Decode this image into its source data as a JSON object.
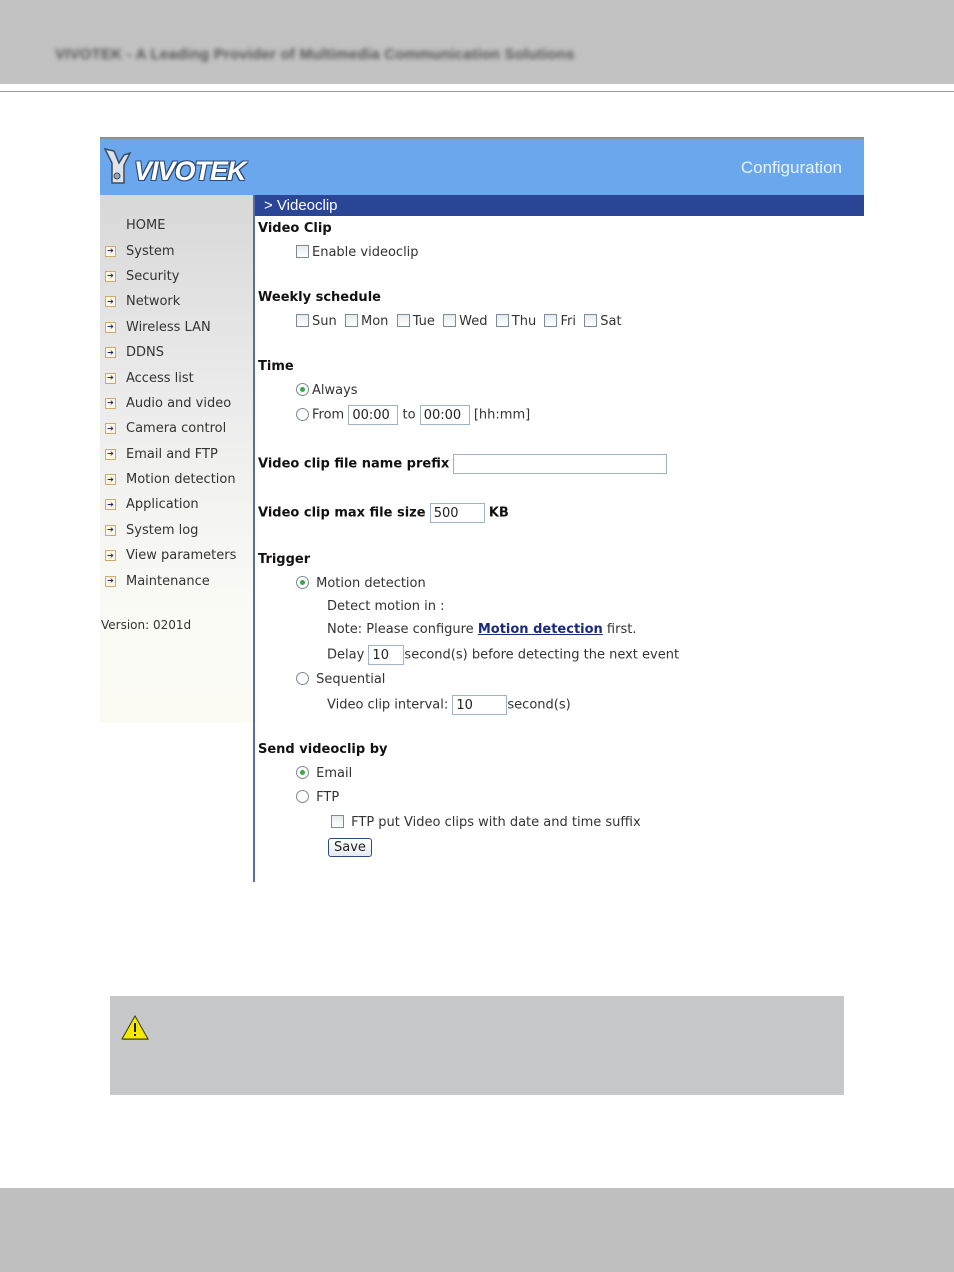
{
  "document": {
    "header_tagline": "VIVOTEK - A Leading Provider of Multimedia Communication Solutions"
  },
  "app": {
    "logo_text": "VIVOTEK",
    "banner_title": "Configuration",
    "section_title": "> Videoclip",
    "accent_color": "#2b4596",
    "banner_color": "#6ba7ec"
  },
  "sidebar": {
    "items": [
      {
        "label": "HOME",
        "icon": "none"
      },
      {
        "label": "System",
        "icon": "arrow-right-icon"
      },
      {
        "label": "Security",
        "icon": "arrow-right-icon"
      },
      {
        "label": "Network",
        "icon": "arrow-right-icon"
      },
      {
        "label": "Wireless LAN",
        "icon": "arrow-right-icon"
      },
      {
        "label": "DDNS",
        "icon": "arrow-right-icon"
      },
      {
        "label": "Access list",
        "icon": "arrow-right-icon"
      },
      {
        "label": "Audio and video",
        "icon": "arrow-right-icon"
      },
      {
        "label": "Camera control",
        "icon": "arrow-right-icon"
      },
      {
        "label": "Email and FTP",
        "icon": "arrow-right-icon"
      },
      {
        "label": "Motion detection",
        "icon": "arrow-right-icon"
      },
      {
        "label": "Application",
        "icon": "arrow-right-icon"
      },
      {
        "label": "System log",
        "icon": "arrow-right-icon"
      },
      {
        "label": "View parameters",
        "icon": "arrow-right-icon"
      },
      {
        "label": "Maintenance",
        "icon": "arrow-right-icon"
      }
    ],
    "version": "Version: 0201d"
  },
  "form": {
    "video_clip": {
      "heading": "Video Clip",
      "enable_label": "Enable videoclip",
      "enable_checked": false
    },
    "weekly_schedule": {
      "heading": "Weekly schedule",
      "days": [
        {
          "label": "Sun",
          "checked": false
        },
        {
          "label": "Mon",
          "checked": false
        },
        {
          "label": "Tue",
          "checked": false
        },
        {
          "label": "Wed",
          "checked": false
        },
        {
          "label": "Thu",
          "checked": false
        },
        {
          "label": "Fri",
          "checked": false
        },
        {
          "label": "Sat",
          "checked": false
        }
      ]
    },
    "time": {
      "heading": "Time",
      "always_label": "Always",
      "always_selected": true,
      "from_label": "From",
      "from_value": "00:00",
      "to_label": "to",
      "to_value": "00:00",
      "format_hint": "[hh:mm]"
    },
    "prefix": {
      "label": "Video clip file name prefix",
      "value": ""
    },
    "max_size": {
      "label": "Video clip max file size",
      "value": "500",
      "unit": "KB"
    },
    "trigger": {
      "heading": "Trigger",
      "motion_label": "Motion detection",
      "motion_selected": true,
      "detect_in_label": "Detect motion in :",
      "note_prefix": "Note: Please configure ",
      "note_link": "Motion detection",
      "note_suffix": " first.",
      "delay_label": "Delay",
      "delay_value": "10",
      "delay_suffix": "second(s) before detecting the next event",
      "sequential_label": "Sequential",
      "sequential_selected": false,
      "interval_label": "Video clip interval:",
      "interval_value": "10",
      "interval_suffix": "second(s)"
    },
    "send_by": {
      "heading": "Send videoclip by",
      "email_label": "Email",
      "email_selected": true,
      "ftp_label": "FTP",
      "ftp_selected": false,
      "ftp_suffix_label": "FTP put Video clips with date and time suffix",
      "ftp_suffix_checked": false
    },
    "save_label": "Save"
  },
  "note_box": {
    "icon": "warning-icon"
  }
}
